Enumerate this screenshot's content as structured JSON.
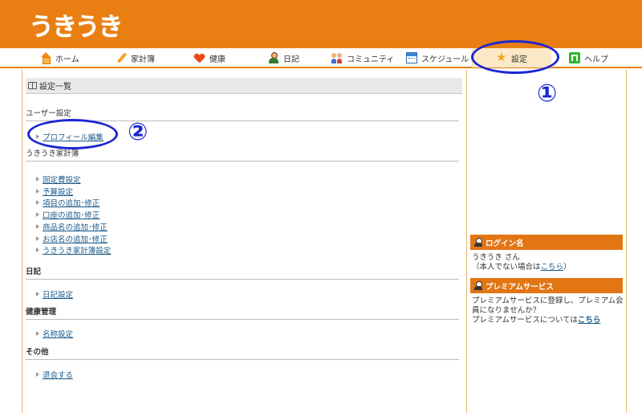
{
  "header": {
    "logo": "うきうき"
  },
  "nav": {
    "items": [
      {
        "label": "ホーム",
        "icon": "home-icon"
      },
      {
        "label": "家計簿",
        "icon": "pen-icon"
      },
      {
        "label": "健康",
        "icon": "heart-icon"
      },
      {
        "label": "日記",
        "icon": "person-icon"
      },
      {
        "label": "コミュニティ",
        "icon": "people-icon"
      },
      {
        "label": "スケジュール",
        "icon": "calendar-icon"
      },
      {
        "label": "設定",
        "icon": "star-icon",
        "active": true
      },
      {
        "label": "ヘルプ",
        "icon": "help-icon"
      }
    ]
  },
  "main": {
    "title": "設定一覧",
    "sections": [
      {
        "heading": "ユーザー設定",
        "links": [
          "プロフィール編集"
        ]
      },
      {
        "heading": "うきうき家計簿",
        "links": [
          "固定費設定",
          "予算設定",
          "項目の追加･修正",
          "口座の追加･修正",
          "商品名の追加･修正",
          "お店名の追加･修正",
          "うきうき家計簿設定"
        ]
      },
      {
        "heading": "日記",
        "links": [
          "日記設定"
        ]
      },
      {
        "heading": "健康管理",
        "links": [
          "名称設定"
        ]
      },
      {
        "heading": "その他",
        "links": [
          "退会する"
        ]
      }
    ]
  },
  "sidebar": {
    "login": {
      "heading": "ログイン名",
      "name": "うきうき さん",
      "note_prefix": "（本人でない場合は",
      "note_link": "こちら",
      "note_suffix": "）"
    },
    "premium": {
      "heading": "プレミアムサービス",
      "line1": "プレミアムサービスに登録し、プレミアム会",
      "line2": "員になりませんか？",
      "line3_prefix": "プレミアムサービスについては",
      "line3_link": "こちら"
    }
  },
  "annotations": {
    "marker1": "①",
    "marker2": "②",
    "color": "#1b27d3"
  },
  "colors": {
    "brand_orange": "#e97f12",
    "link": "#1a5a8a"
  }
}
